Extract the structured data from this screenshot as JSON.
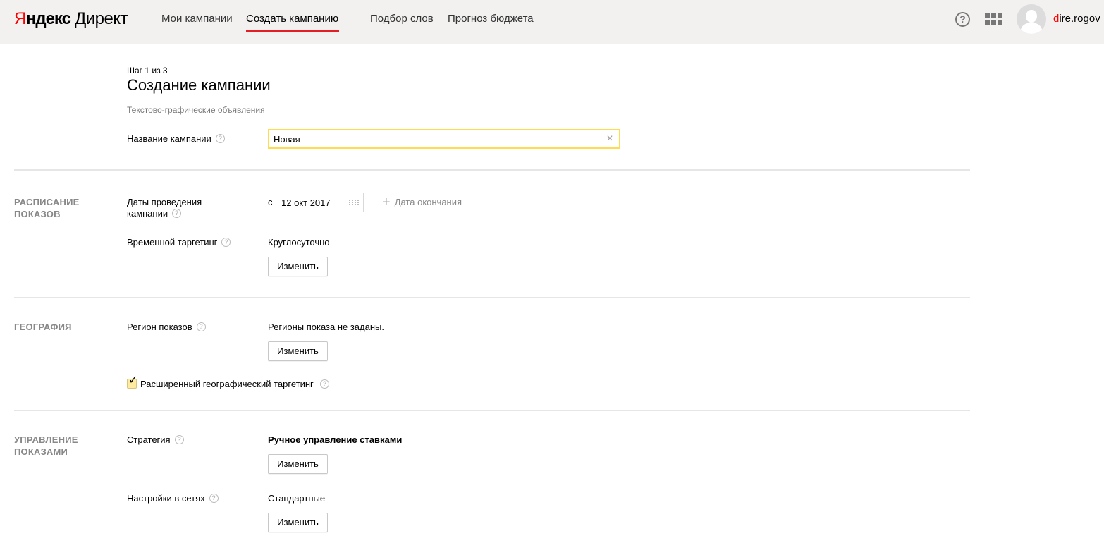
{
  "header": {
    "logo": {
      "first_letter": "Я",
      "rest": "ндекс",
      "product": "Директ"
    },
    "nav": [
      {
        "label": "Мои кампании",
        "active": false
      },
      {
        "label": "Создать кампанию",
        "active": true
      },
      {
        "label": "Подбор слов",
        "active": false
      },
      {
        "label": "Прогноз бюджета",
        "active": false
      }
    ],
    "help_symbol": "?",
    "user": {
      "first_letter": "d",
      "rest": "ire.rogov"
    },
    "accent_color": "#e31e24"
  },
  "page": {
    "step": "Шаг 1 из 3",
    "title": "Создание кампании",
    "subtitle": "Текстово-графические объявления"
  },
  "campaign_name": {
    "label": "Название кампании",
    "value": "Новая",
    "clear_symbol": "×"
  },
  "schedule": {
    "section_title": "РАСПИСАНИЕ ПОКАЗОВ",
    "dates_label": "Даты проведения кампании",
    "date_prefix": "с",
    "start_date": "12 окт 2017",
    "add_end_plus": "+",
    "add_end_label": "Дата окончания",
    "time_targeting_label": "Временной таргетинг",
    "time_targeting_value": "Круглосуточно",
    "change_label": "Изменить"
  },
  "geography": {
    "section_title": "ГЕОГРАФИЯ",
    "region_label": "Регион показов",
    "region_value": "Регионы показа не заданы.",
    "change_label": "Изменить",
    "extended_label": "Расширенный географический таргетинг",
    "extended_checked": true,
    "check_symbol": "✓"
  },
  "management": {
    "section_title": "УПРАВЛЕНИЕ ПОКАЗАМИ",
    "strategy_label": "Стратегия",
    "strategy_value": "Ручное управление ставками",
    "change_label": "Изменить",
    "network_label": "Настройки в сетях",
    "network_value": "Стандартные",
    "network_change_label": "Изменить"
  },
  "tooltip_symbol": "?"
}
